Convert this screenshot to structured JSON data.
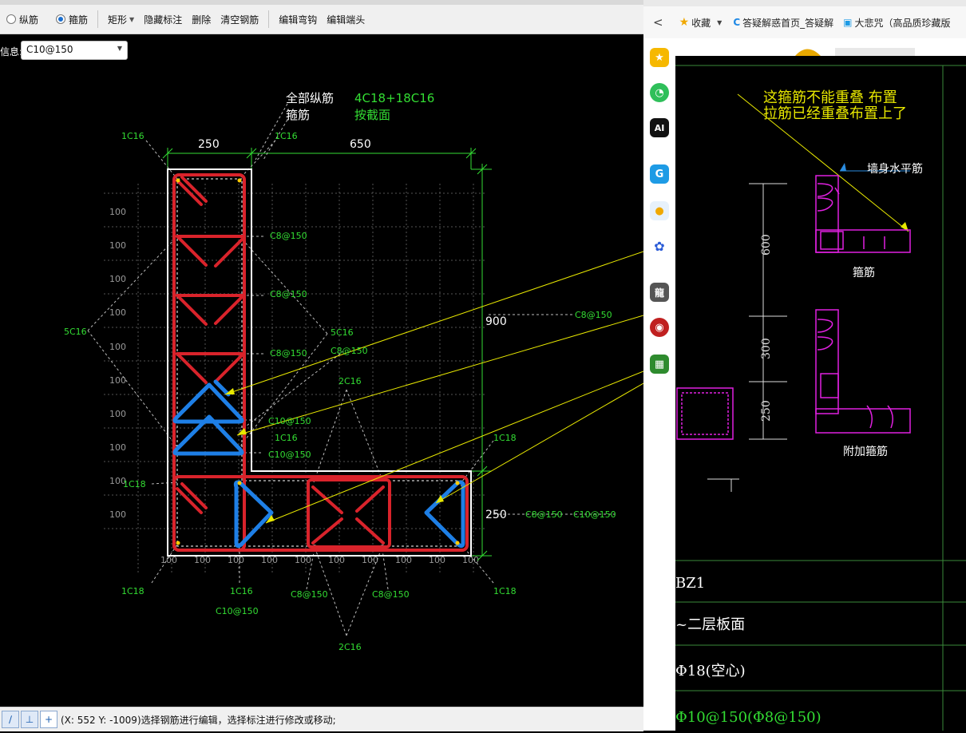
{
  "toolbar": {
    "radio_longitudinal": "纵筋",
    "radio_stirrup": "箍筋",
    "shape_menu": "矩形",
    "hide_annotation": "隐藏标注",
    "delete": "删除",
    "clear_rebar": "清空钢筋",
    "edit_hook": "编辑弯钩",
    "edit_end": "编辑端头"
  },
  "info": {
    "label": "信息:",
    "value": "C10@150"
  },
  "drawing": {
    "header_longitudinal_label": "全部纵筋",
    "header_longitudinal_value": "4C18+18C16",
    "header_stirrup_label": "箍筋",
    "header_stirrup_value": "按截面",
    "dim_250_top": "250",
    "dim_650": "650",
    "dim_900": "900",
    "dim_250_right": "250",
    "grid_100": "100",
    "labels": {
      "c16_top_left": "1C16",
      "c16_top_mid": "1C16",
      "c16_left_side": "5C16",
      "c16_diag": "5C16",
      "c8_1": "C8@150",
      "c8_2": "C8@150",
      "c8_3": "C8@150",
      "c8_4": "C8@150",
      "c8_right": "C8@150",
      "c10_1": "C10@150",
      "c10_2": "C10@150",
      "c16_mid": "1C16",
      "c16_2": "2C16",
      "c16_2_bottom": "2C16",
      "c18_right_top": "1C18",
      "c18_left": "1C18",
      "c18_bl": "1C18",
      "c18_br": "1C18",
      "c16_bottom": "1C16",
      "c10_bottom": "C10@150",
      "c8_bottom_l": "C8@150",
      "c8_bottom_r": "C8@150",
      "dim_right_c8": "C8@150",
      "dim_right_c10": "C10@150"
    }
  },
  "status": {
    "text": "(X: 552 Y: -1009)选择钢筋进行编辑，选择标注进行修改或移动;"
  },
  "browser": {
    "back": "<",
    "favorites": "收藏",
    "bookmark_1": "答疑解惑首页_答疑解",
    "bookmark_2": "大悲咒（高品质珍藏版"
  },
  "right_drawing": {
    "note_line1": "这箍筋不能重叠 布置",
    "note_line2": "拉筋已经重叠布置上了",
    "wall_rebar": "墙身水平筋",
    "stirrup": "箍筋",
    "extra_stirrup": "附加箍筋",
    "dim_600": "600",
    "dim_300": "300",
    "dim_250": "250",
    "bz1": "BZ1",
    "floor": "~二层板面",
    "row_rebar": "Φ18(空心)",
    "row_stirrup": "Φ10@150(Φ8@150)"
  },
  "colors": {
    "red_stirrup": "#d9232b",
    "blue_stirrup": "#1e7fe6",
    "green_text": "#33dd33",
    "yellow_leader": "#e8e800",
    "magenta": "#e020e0"
  }
}
